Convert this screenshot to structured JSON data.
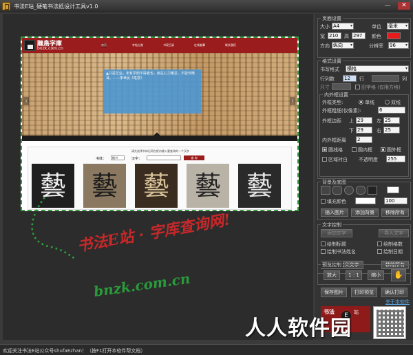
{
  "window": {
    "title": "书法E站_硬笔书法纸设计工具v1.0"
  },
  "website": {
    "name": "蹦鳥字庫",
    "url": "bnzk.com.cn",
    "nav": [
      "首页",
      "字帖分类",
      "书家目录",
      "在线临摹",
      "联系我们"
    ],
    "hero_text": "▲只是艺业，未有学而不得者也，病在心力懈怠，不能专精耳。——李世民《笔意》",
    "arrow_left": "‹",
    "arrow_right": "›",
    "search_hint": "请先选择书体后再在框内输入要查询的一个汉字",
    "search_font_label": "书体：",
    "search_font_value": "楷书",
    "search_char_label": "汉字：",
    "search_button": "查 询",
    "glyphs": [
      "藝",
      "藝",
      "藝",
      "藝",
      "藝"
    ]
  },
  "promo": {
    "line1": "书法E站 · 字库查询网!",
    "line2": "bnzk.com.cn"
  },
  "panel": {
    "page_settings": {
      "title": "页面设置",
      "size_label": "大小",
      "size_value": "A4",
      "unit_label": "单位",
      "unit_value": "毫米",
      "width_label": "宽",
      "width_value": "210",
      "height_label": "高",
      "height_value": "297",
      "color_label": "颜色",
      "direction_label": "方向",
      "direction_value": "纵向",
      "resolution_label": "分辨率",
      "resolution_value": "96"
    },
    "grid_style": {
      "title": "格式设置",
      "style_label": "书写格式",
      "style_value": "横格",
      "rows_label": "行列数",
      "rows_value": "12",
      "row_unit": "行",
      "cols_unit": "列",
      "size_label": "尺寸",
      "square_label": "田字格 (仅限方格)",
      "border_group_title": "内外框设置",
      "outer_type_label": "外框类型:",
      "single_line": "单线",
      "double_line": "双线",
      "outer_thickness_label": "外框粗细(仅像素):",
      "outer_thickness_value": "6",
      "outer_margin_label": "外框边距",
      "top_label": "上",
      "top_value": "29",
      "left_label": "左",
      "left_value": "25",
      "bottom_label": "下",
      "bottom_value": "29",
      "right_label": "右",
      "right_value": "25",
      "inner_margin_label": "内外框距离",
      "inner_margin_value": "2",
      "circle_line": "圆线格",
      "inner_frame": "圆内框",
      "outer_frame": "圆外框",
      "area_fill": "区域衬白",
      "opacity_label": "不透明度",
      "opacity_value": "255"
    },
    "background": {
      "title": "背景及底图",
      "fill_label": "填充颜色",
      "fill_value": "100",
      "insert_image": "插入图片",
      "add_background": "添加背景",
      "remove_all": "移除所有"
    },
    "text_settings": {
      "title": "文字控制",
      "add_text": "添加文字",
      "import_text": "导入文字",
      "draw_title": "绘制标题",
      "draw_page_no": "绘制格数",
      "draw_author": "绘制书法姓名",
      "draw_date": "绘制日期",
      "insert_custom": "插入自定义文字",
      "remove_all": "移除所有"
    },
    "preview_control": {
      "title": "预览控制",
      "zoom_in": "放大",
      "actual": "1 : 1",
      "zoom_out": "缩小"
    },
    "actions": {
      "save_image": "保存图片",
      "print_preview": "打印预览",
      "confirm_print": "确认打印",
      "about": "关于本软件"
    },
    "brand": {
      "line1": "书法",
      "e": "E",
      "line2": "站"
    }
  },
  "status": {
    "text": "欢迎关注书法E站公众号shufaEzhan！（按F1打开本软件帮文档）"
  },
  "watermark": {
    "text": "人人软件园"
  },
  "colors": {
    "accent_red": "#e61b1b",
    "promo_green": "#2a9a3a",
    "promo_red": "#c7282a",
    "dashed_border": "#2f9b3a"
  }
}
